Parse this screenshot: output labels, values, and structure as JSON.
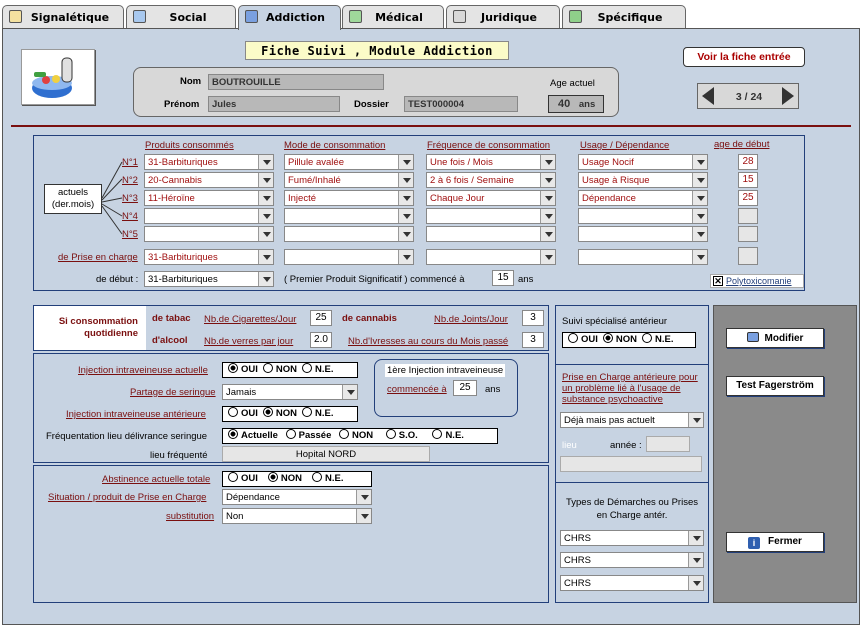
{
  "tabs": [
    {
      "label": "Signalétique"
    },
    {
      "label": "Social"
    },
    {
      "label": "Addiction"
    },
    {
      "label": "Médical"
    },
    {
      "label": "Juridique"
    },
    {
      "label": "Spécifique"
    }
  ],
  "header": {
    "title": "Fiche Suivi , Module Addiction",
    "voir_btn": "Voir la fiche entrée",
    "nom_label": "Nom",
    "nom": "BOUTROUILLE",
    "prenom_label": "Prénom",
    "prenom": "Jules",
    "dossier_label": "Dossier",
    "dossier": "TEST000004",
    "age_label": "Age actuel",
    "age": "40",
    "age_unit": "ans",
    "pager": "3 / 24"
  },
  "products": {
    "headers": {
      "produits": "Produits consommés",
      "mode": "Mode de consommation",
      "frequence": "Fréquence de consommation",
      "usage": "Usage / Dépendance",
      "age": "age de début"
    },
    "actuels": "actuels\n(der.mois)",
    "rows": [
      {
        "label": "N°1",
        "produit": "31-Barbituriques",
        "mode": "Pillule avalée",
        "freq": "Une fois / Mois",
        "usage": "Usage Nocif",
        "age": "28"
      },
      {
        "label": "N°2",
        "produit": "20-Cannabis",
        "mode": "Fumé/Inhalé",
        "freq": "2 à 6 fois / Semaine",
        "usage": "Usage à Risque",
        "age": "15"
      },
      {
        "label": "N°3",
        "produit": "11-Héroïne",
        "mode": "Injecté",
        "freq": "Chaque Jour",
        "usage": "Dépendance",
        "age": "25"
      },
      {
        "label": "N°4",
        "produit": "",
        "mode": "",
        "freq": "",
        "usage": "",
        "age": ""
      },
      {
        "label": "N°5",
        "produit": "",
        "mode": "",
        "freq": "",
        "usage": "",
        "age": ""
      }
    ],
    "prise_label": "de Prise en charge",
    "prise": "31-Barbituriques",
    "debut_label": "de début :",
    "debut": "31-Barbituriques",
    "premier": "( Premier Produit Significatif ) commencé à",
    "premier_age": "15",
    "premier_unit": "ans",
    "poly": "Polytoxicomanie"
  },
  "quotidien": {
    "label": "Si consommation quotidienne",
    "tabac": "de tabac",
    "cig_label": "Nb.de Cigarettes/Jour",
    "cig": "25",
    "cannabis": "de cannabis",
    "joints_label": "Nb.de Joints/Jour",
    "joints": "3",
    "alcool": "d'alcool",
    "verres_label": "Nb.de verres par jour",
    "verres": "2.0",
    "ivresse_label": "Nb.d'Ivresses au cours du Mois passé",
    "ivresse": "3"
  },
  "injection": {
    "actuelle_label": "Injection intraveineuse actuelle",
    "actuelle": [
      "OUI",
      "NON",
      "N.E."
    ],
    "partage_label": "Partage de seringue",
    "partage": "Jamais",
    "anterieure_label": "Injection intraveineuse antérieure",
    "anterieure": [
      "OUI",
      "NON",
      "N.E."
    ],
    "premiere_title": "1ère Injection intraveineuse",
    "premiere_label": "commencée à",
    "premiere_age": "25",
    "premiere_unit": "ans",
    "frequentation_label": "Fréquentation lieu délivrance seringue",
    "frequentation": [
      "Actuelle",
      "Passée",
      "NON",
      "S.O.",
      "N.E."
    ],
    "lieu_label": "lieu fréquenté",
    "lieu": "Hopital NORD"
  },
  "abstinence": {
    "label": "Abstinence actuelle totale",
    "opts": [
      "OUI",
      "NON",
      "N.E."
    ],
    "situation_label": "Situation / produit de Prise en Charge",
    "situation": "Dépendance",
    "substitution_label": "substitution",
    "substitution": "Non"
  },
  "suivi": {
    "label": "Suivi spécialisé antérieur",
    "opts": [
      "OUI",
      "NON",
      "N.E."
    ],
    "prise_label": "Prise en Charge antérieure pour un problème lié à l'usage de substance psychoactive",
    "prise_value": "Déjà mais pas actuelt",
    "lieu_label": "lieu",
    "annee_label": "année :",
    "types_label": "Types de Démarches ou Prises en Charge antér.",
    "types": [
      "CHRS",
      "CHRS",
      "CHRS"
    ]
  },
  "buttons": {
    "modifier": "Modifier",
    "fagerstrom": "Test Fagerström",
    "fermer": "Fermer"
  }
}
